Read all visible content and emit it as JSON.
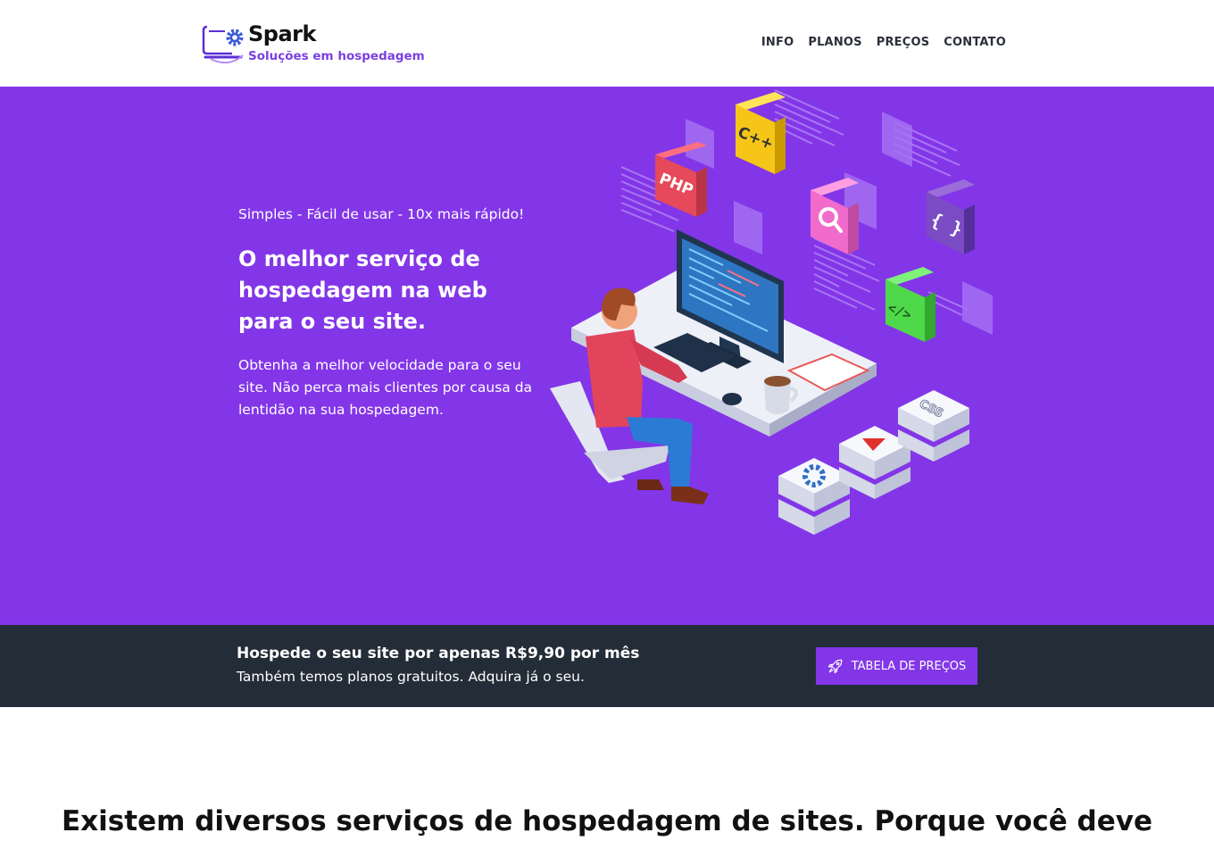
{
  "brand": {
    "name": "Spark",
    "tagline": "Soluções em hospedagem",
    "accent_color": "#8336e8"
  },
  "nav": {
    "items": [
      {
        "label": "INFO"
      },
      {
        "label": "PLANOS"
      },
      {
        "label": "PREÇOS"
      },
      {
        "label": "CONTATO"
      }
    ]
  },
  "hero": {
    "subtitle": "Simples - Fácil de usar - 10x mais rápido!",
    "title": "O melhor serviço de hospedagem na web para o seu site.",
    "text": "Obtenha a melhor velocidade para o seu site. Não perca mais clientes por causa da lentidão na sua hospedagem.",
    "illustration_tags": [
      "PHP",
      "C++",
      "{ }",
      "</>",
      "CSS"
    ]
  },
  "promo": {
    "title": "Hospede o seu site por apenas R$9,90 por mês",
    "text": "Também temos planos gratuitos. Adquira já o seu.",
    "button_label": "TABELA DE PREÇOS",
    "button_icon": "rocket-icon",
    "background_color": "#232d37"
  },
  "section": {
    "title": "Existem diversos serviços de hospedagem de sites. Porque você deve"
  }
}
